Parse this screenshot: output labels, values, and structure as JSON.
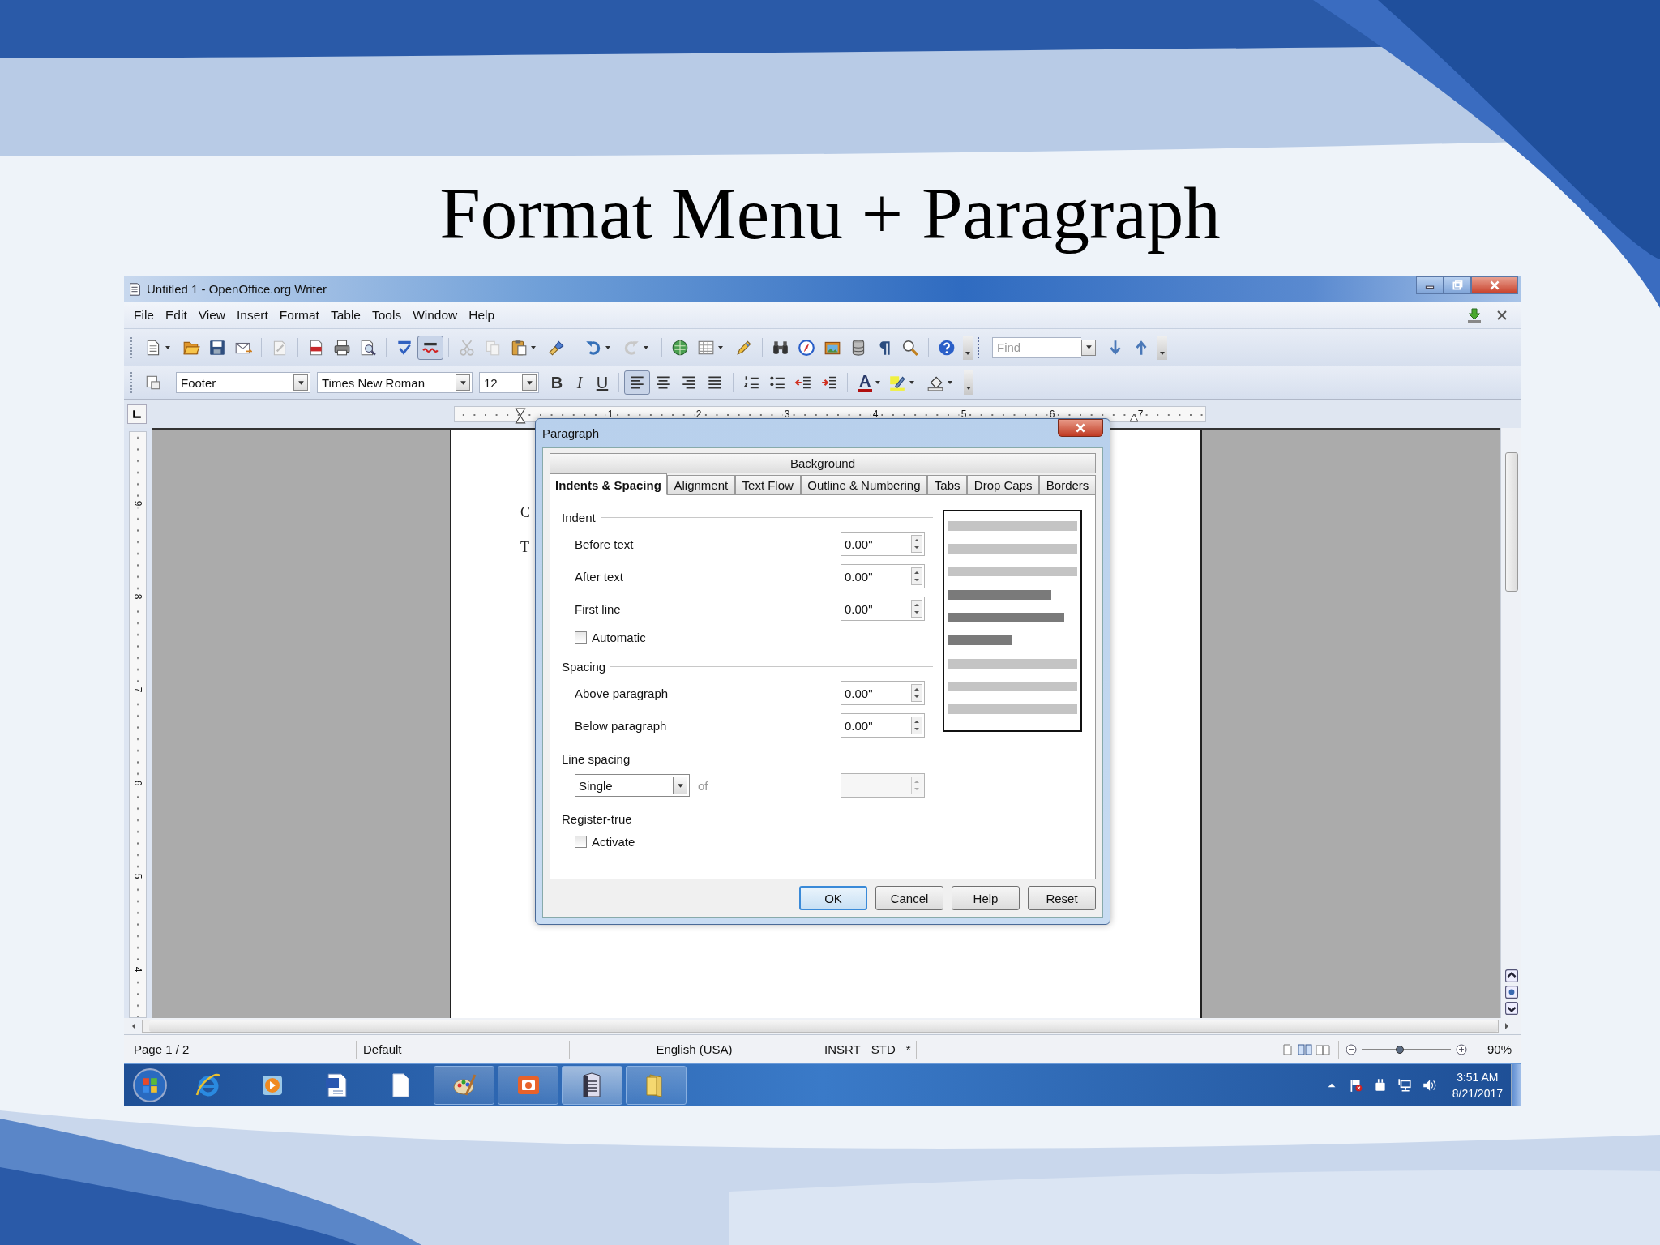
{
  "slide": {
    "title": "Format Menu + Paragraph"
  },
  "window": {
    "title": "Untitled 1 - OpenOffice.org Writer"
  },
  "menu": [
    "File",
    "Edit",
    "View",
    "Insert",
    "Format",
    "Table",
    "Tools",
    "Window",
    "Help"
  ],
  "standard_toolbar": {
    "autospell_pressed": true
  },
  "find_toolbar": {
    "placeholder": "Find"
  },
  "formatting_toolbar": {
    "paragraph_style": "Footer",
    "font_name": "Times New Roman",
    "font_size": "12",
    "style_buttons": [
      {
        "kind": "bold",
        "label": "B"
      },
      {
        "kind": "italic",
        "label": "I"
      },
      {
        "kind": "underline",
        "label": "U"
      }
    ],
    "alignment": [
      {
        "selected": true
      },
      {
        "selected": false
      },
      {
        "selected": false
      },
      {
        "selected": false
      }
    ],
    "font_color_label": "A"
  },
  "ruler": {
    "h_numbers": [
      "1",
      "2",
      "3",
      "4",
      "5",
      "6",
      "7"
    ],
    "v_numbers": [
      "9",
      "8",
      "7",
      "6",
      "5",
      "4"
    ]
  },
  "document": {
    "fragments": [
      "C",
      "T"
    ]
  },
  "dialog": {
    "title": "Paragraph",
    "tabs_row_1": [
      {
        "label": "Background",
        "selected": false
      }
    ],
    "tabs_row_2": [
      {
        "label": "Indents & Spacing",
        "selected": true
      },
      {
        "label": "Alignment",
        "selected": false
      },
      {
        "label": "Text Flow",
        "selected": false
      },
      {
        "label": "Outline & Numbering",
        "selected": false
      },
      {
        "label": "Tabs",
        "selected": false
      },
      {
        "label": "Drop Caps",
        "selected": false
      },
      {
        "label": "Borders",
        "selected": false
      }
    ],
    "sections": [
      {
        "title": "Indent",
        "rows": [
          {
            "kind": "spin",
            "label": "Before text",
            "value": "0.00\""
          },
          {
            "kind": "spin",
            "label": "After text",
            "value": "0.00\""
          },
          {
            "kind": "spin",
            "label": "First line",
            "value": "0.00\""
          },
          {
            "kind": "checkbox",
            "label": "Automatic",
            "checked": false
          }
        ]
      },
      {
        "title": "Spacing",
        "rows": [
          {
            "kind": "spin",
            "label": "Above paragraph",
            "value": "0.00\""
          },
          {
            "kind": "spin",
            "label": "Below paragraph",
            "value": "0.00\""
          }
        ]
      },
      {
        "title": "Line spacing",
        "rows": [
          {
            "kind": "select",
            "value": "Single",
            "of_label": "of",
            "disabled": true
          }
        ]
      },
      {
        "title": "Register-true",
        "rows": [
          {
            "kind": "checkbox",
            "label": "Activate",
            "checked": false
          }
        ]
      }
    ],
    "buttons": [
      {
        "label": "OK",
        "default": true
      },
      {
        "label": "Cancel",
        "default": false
      },
      {
        "label": "Help",
        "default": false
      },
      {
        "label": "Reset",
        "default": false
      }
    ]
  },
  "status_bar": {
    "page": "Page 1 / 2",
    "style": "Default",
    "language": "English (USA)",
    "insert_mode": "INSRT",
    "selection_mode": "STD",
    "modified": "*",
    "zoom_slider": {
      "level": 0.43
    },
    "zoom": "90%"
  },
  "taskbar": {
    "apps": [
      {
        "running": false,
        "selected": false
      },
      {
        "running": false,
        "selected": false
      },
      {
        "running": false,
        "selected": false
      },
      {
        "running": false,
        "selected": false
      },
      {
        "running": true,
        "selected": false
      },
      {
        "running": true,
        "selected": false
      },
      {
        "running": true,
        "selected": true
      },
      {
        "running": true,
        "selected": false
      }
    ],
    "time": "3:51 AM",
    "date": "8/21/2017"
  }
}
